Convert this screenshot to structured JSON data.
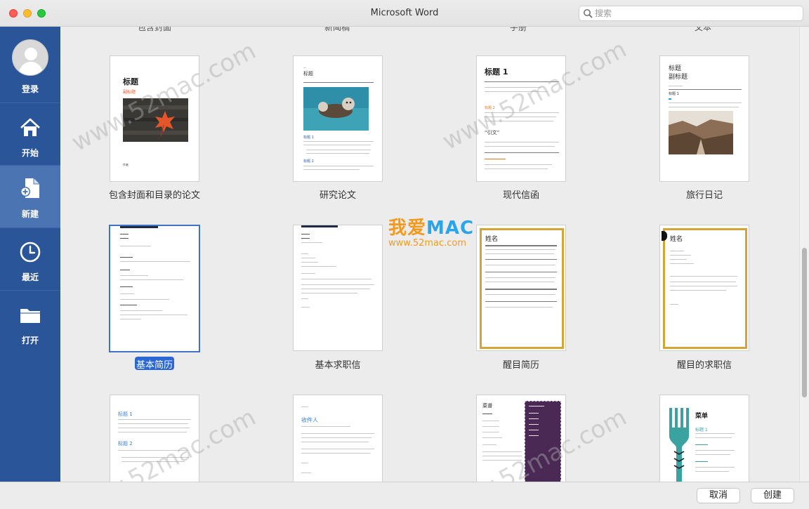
{
  "window": {
    "title": "Microsoft Word"
  },
  "search": {
    "placeholder": "搜索"
  },
  "sidebar": {
    "items": [
      {
        "label": "登录",
        "icon": "avatar"
      },
      {
        "label": "开始",
        "icon": "home-icon"
      },
      {
        "label": "新建",
        "icon": "new-document-icon",
        "active": true
      },
      {
        "label": "最近",
        "icon": "clock-icon"
      },
      {
        "label": "打开",
        "icon": "folder-icon"
      }
    ]
  },
  "top_row_labels": [
    "包含封面",
    "新闻稿",
    "手册",
    "文本"
  ],
  "templates": {
    "row1": [
      {
        "label": "包含封面和目录的论文",
        "title": "标题",
        "subtitle": "副标题",
        "footer": "作者"
      },
      {
        "label": "研究论文",
        "title": "标题",
        "heading1": "标题 1",
        "heading2": "标题 2"
      },
      {
        "label": "现代信函",
        "title": "标题 1",
        "heading": "标题 2",
        "quote": "“引文”"
      },
      {
        "label": "旅行日记",
        "title": "标题",
        "subtitle": "副标题",
        "heading": "标题 1"
      }
    ],
    "row2": [
      {
        "label": "基本简历",
        "selected": true
      },
      {
        "label": "基本求职信"
      },
      {
        "label": "醒目简历",
        "name": "姓名"
      },
      {
        "label": "醒目的求职信",
        "name": "姓名"
      }
    ],
    "row3": [
      {
        "title": "标题 1",
        "heading": "标题 2"
      },
      {
        "title": "收件人"
      },
      {
        "title": "菜谱",
        "sub": "副标题"
      },
      {
        "title": "菜单",
        "heading": "标题 1"
      }
    ]
  },
  "watermark": {
    "site": "www.52mac.com",
    "brand": "我爱",
    "brand_mac": "MAC"
  },
  "buttons": {
    "cancel": "取消",
    "create": "创建"
  },
  "colors": {
    "sidebar": "#2a5699",
    "sidebar_active": "#4a74b2",
    "selection": "#2b66d4",
    "gold_border": "#d4a437"
  }
}
